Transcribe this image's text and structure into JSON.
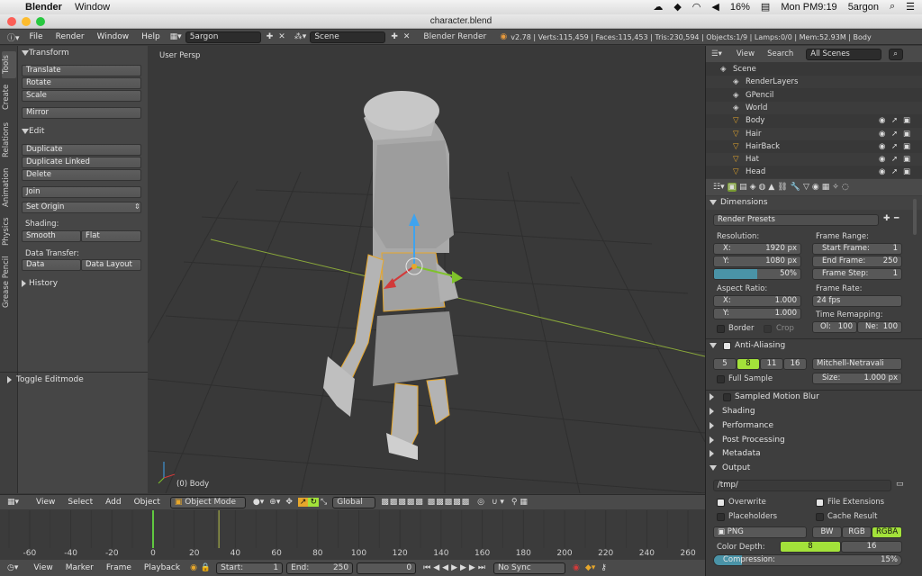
{
  "mac": {
    "apple": "",
    "app": "Blender",
    "menu": "Window",
    "battery": "16%",
    "clock": "Mon PM9:19",
    "user": "5argon"
  },
  "window_title": "character.blend",
  "info": {
    "menus": [
      "File",
      "Render",
      "Window",
      "Help"
    ],
    "screen": "5argon",
    "scene": "Scene",
    "engine": "Blender Render",
    "stats": "v2.78 | Verts:115,459 | Faces:115,453 | Tris:230,594 | Objects:1/9 | Lamps:0/0 | Mem:52.93M | Body"
  },
  "tabs": [
    "Tools",
    "Create",
    "Relations",
    "Animation",
    "Physics",
    "Grease Pencil"
  ],
  "tools": {
    "transform": "Transform",
    "translate": "Translate",
    "rotate": "Rotate",
    "scale": "Scale",
    "mirror": "Mirror",
    "edit": "Edit",
    "duplicate": "Duplicate",
    "duplicate_linked": "Duplicate Linked",
    "delete": "Delete",
    "join": "Join",
    "set_origin": "Set Origin",
    "shading": "Shading:",
    "smooth": "Smooth",
    "flat": "Flat",
    "data_transfer": "Data Transfer:",
    "data": "Data",
    "data_layout": "Data Layout",
    "history": "History",
    "toggle_editmode": "Toggle Editmode"
  },
  "viewport": {
    "label": "User Persp",
    "object": "(0) Body"
  },
  "outliner": {
    "menus": [
      "View",
      "Search"
    ],
    "filter": "All Scenes",
    "rows": [
      "Scene",
      "RenderLayers",
      "GPencil",
      "World",
      "Body",
      "Hair",
      "HairBack",
      "Hat",
      "Head"
    ]
  },
  "props": {
    "dimensions": "Dimensions",
    "render_presets": "Render Presets",
    "resolution": "Resolution:",
    "res_x_label": "X:",
    "res_x": "1920 px",
    "res_y_label": "Y:",
    "res_y": "1080 px",
    "res_pct": "50%",
    "frame_range": "Frame Range:",
    "start_label": "Start Frame:",
    "start": "1",
    "end_label": "End Frame:",
    "end": "250",
    "step_label": "Frame Step:",
    "step": "1",
    "aspect": "Aspect Ratio:",
    "asp_x_label": "X:",
    "asp_x": "1.000",
    "asp_y_label": "Y:",
    "asp_y": "1.000",
    "frame_rate": "Frame Rate:",
    "fps": "24 fps",
    "border": "Border",
    "crop": "Crop",
    "time_remap": "Time Remapping:",
    "old_label": "Ol:",
    "old": "100",
    "new_label": "Ne:",
    "new": "100",
    "aa": "Anti-Aliasing",
    "aa_samples": [
      "5",
      "8",
      "11",
      "16"
    ],
    "aa_filter": "Mitchell-Netravali",
    "full_sample": "Full Sample",
    "size_label": "Size:",
    "size": "1.000 px",
    "motion_blur": "Sampled Motion Blur",
    "shading": "Shading",
    "performance": "Performance",
    "post_processing": "Post Processing",
    "metadata": "Metadata",
    "output": "Output",
    "path": "/tmp/",
    "overwrite": "Overwrite",
    "file_ext": "File Extensions",
    "placeholders": "Placeholders",
    "cache_result": "Cache Result",
    "format": "PNG",
    "bw": "BW",
    "rgb": "RGB",
    "rgba": "RGBA",
    "color_depth": "Color Depth:",
    "depth8": "8",
    "depth16": "16",
    "compression": "Compression:",
    "compression_val": "15%"
  },
  "timeline_header": {
    "menus": [
      "View",
      "Select",
      "Add",
      "Object"
    ],
    "mode": "Object Mode",
    "orientation": "Global"
  },
  "timeline": {
    "ticks": [
      "-60",
      "-40",
      "-20",
      "0",
      "20",
      "40",
      "60",
      "80",
      "100",
      "120",
      "140",
      "160",
      "180",
      "200",
      "220",
      "240",
      "260"
    ]
  },
  "timeline_footer": {
    "menus": [
      "View",
      "Marker",
      "Frame",
      "Playback"
    ],
    "start_label": "Start:",
    "start": "1",
    "end_label": "End:",
    "end": "250",
    "current": "0",
    "sync": "No Sync"
  }
}
